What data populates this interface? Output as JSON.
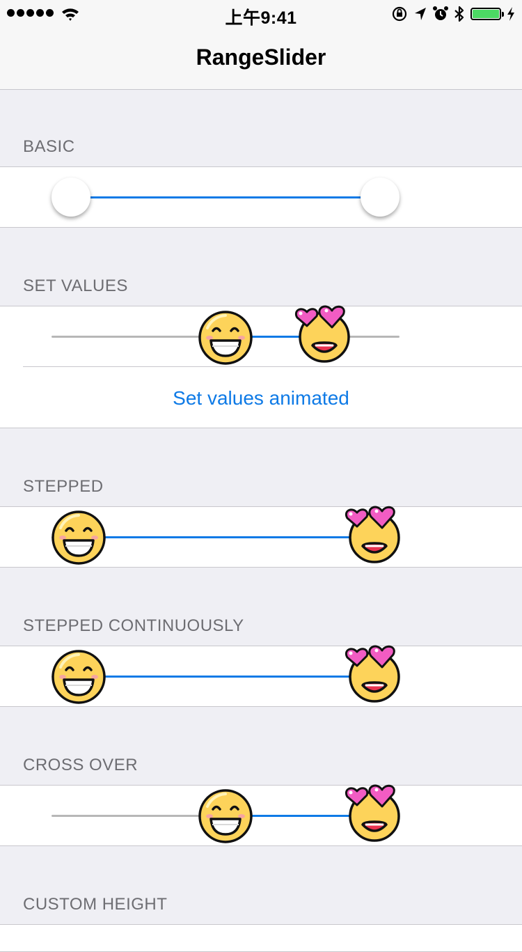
{
  "status_bar": {
    "time": "上午9:41",
    "signal_bars": 5,
    "battery_level": 1.0,
    "battery_color": "#4cd964",
    "icons": [
      "wifi-icon",
      "orientation-lock-icon",
      "location-arrow-icon",
      "alarm-icon",
      "bluetooth-icon",
      "charging-bolt-icon"
    ]
  },
  "nav": {
    "title": "RangeSlider"
  },
  "accent_color": "#0e7ae6",
  "sections": [
    {
      "header": "BASIC",
      "thumb_style": "white-circle",
      "lower": 0.0,
      "upper": 1.0
    },
    {
      "header": "SET VALUES",
      "thumb_style": "emoji",
      "lower": 0.5,
      "upper": 0.83,
      "button_label": "Set values animated"
    },
    {
      "header": "STEPPED",
      "thumb_style": "emoji",
      "lower": 0.0,
      "upper": 1.0
    },
    {
      "header": "STEPPED CONTINUOUSLY",
      "thumb_style": "emoji",
      "lower": 0.0,
      "upper": 1.0
    },
    {
      "header": "CROSS OVER",
      "thumb_style": "emoji",
      "lower": 0.5,
      "upper": 1.0
    },
    {
      "header": "CUSTOM HEIGHT"
    }
  ],
  "thumb_icons": {
    "lower": "grinning-face-icon",
    "upper": "heart-eyes-face-icon"
  }
}
